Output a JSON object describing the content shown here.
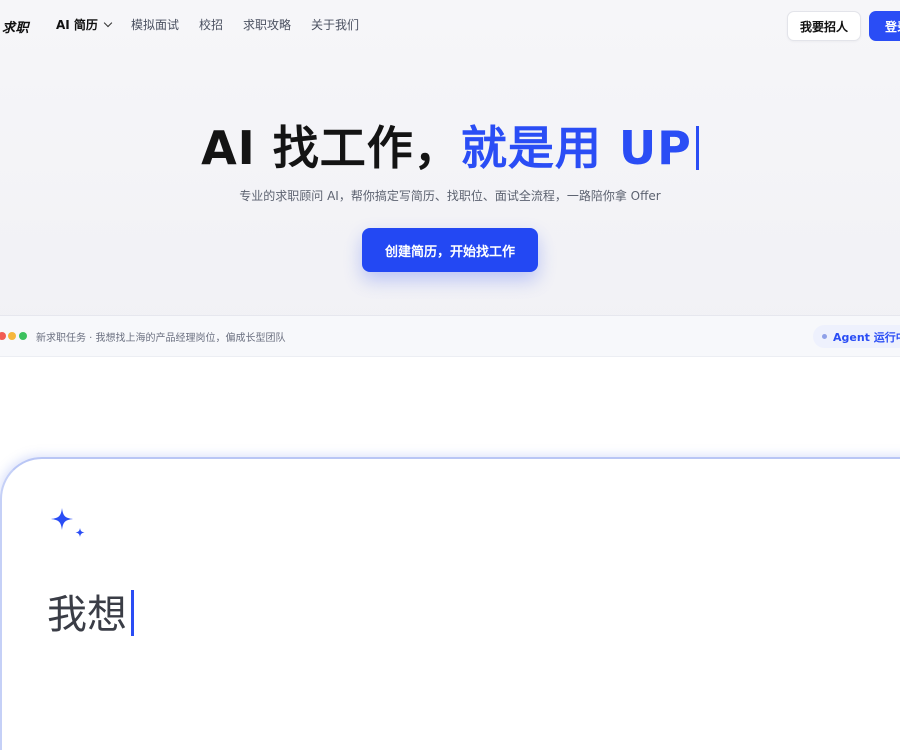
{
  "nav": {
    "brand": "求职",
    "items": [
      {
        "label": "AI 简历"
      },
      {
        "label": "模拟面试"
      },
      {
        "label": "校招"
      },
      {
        "label": "求职攻略"
      },
      {
        "label": "关于我们"
      }
    ],
    "recruit_label": "我要招人",
    "login_label": "登录"
  },
  "hero": {
    "title_main": "AI 找工作，",
    "title_accent": "就是用 UP",
    "subtitle": "专业的求职顾问 AI，帮你搞定写简历、找职位、面试全流程，一路陪你拿 Offer",
    "cta_label": "创建简历，开始找工作"
  },
  "mock": {
    "task_text": "新求职任务 · 我想找上海的产品经理岗位，偏成长型团队",
    "agent_status": "Agent 运行中",
    "typed_text": "我想"
  },
  "colors": {
    "accent": "#2a4df5",
    "dot_red": "#f25c54",
    "dot_yellow": "#f6b73c",
    "dot_green": "#3cc15e"
  },
  "icons": [
    "chevron-down-icon",
    "sparkle-icon"
  ]
}
